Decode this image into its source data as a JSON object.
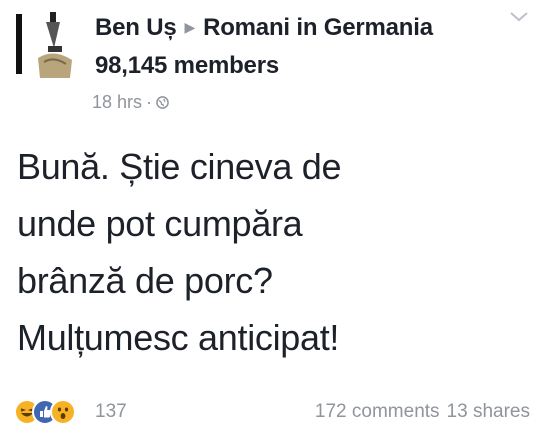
{
  "post": {
    "author": "Ben Uș",
    "group": "Romani in Germania",
    "members": "98,145 members",
    "time": "18 hrs",
    "separator": "·",
    "lines": [
      "Bună. Știe cineva de",
      "unde pot cumpăra",
      "brânză de porc?",
      "Mulțumesc anticipat!"
    ]
  },
  "icons": {
    "arrow": "right-triangle-icon",
    "privacy": "globe-icon",
    "menu": "chevron-down-icon",
    "reactions": [
      "haha-icon",
      "like-icon",
      "wow-icon"
    ]
  },
  "footer": {
    "reaction_count": "137",
    "comments": "172 comments",
    "shares": "13 shares"
  },
  "colors": {
    "text": "#1d2129",
    "muted": "#90949c",
    "like_blue": "#4267b2",
    "reaction_yellow": "#f7b125"
  }
}
